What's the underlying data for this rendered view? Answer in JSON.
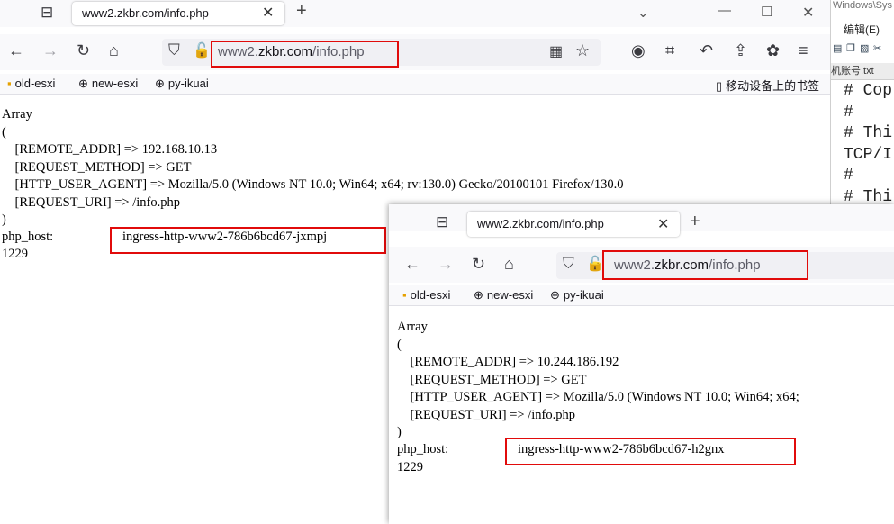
{
  "notepad": {
    "title_partial": "Windows\\Sys",
    "menu_edit": "编辑(E)",
    "tab_label": "机账号.txt",
    "lines": [
      "# Cop",
      "#",
      "# Thi",
      "TCP/I",
      "#",
      "# Thi"
    ]
  },
  "browser1": {
    "tab_title": "www2.zkbr.com/info.php",
    "url_prefix": "www2.",
    "url_host": "zkbr.com",
    "url_path": "/info.php",
    "bookmarks": [
      "old-esxi",
      "new-esxi",
      "py-ikuai"
    ],
    "mobile_bookmarks": "移动设备上的书签",
    "content": {
      "array_open": "Array",
      "paren_open": "(",
      "lines": [
        "    [REMOTE_ADDR] => 192.168.10.13",
        "    [REQUEST_METHOD] => GET",
        "    [HTTP_USER_AGENT] => Mozilla/5.0 (Windows NT 10.0; Win64; x64; rv:130.0) Gecko/20100101 Firefox/130.0",
        "    [REQUEST_URI] => /info.php"
      ],
      "paren_close": ")",
      "php_host_label": "php_host:",
      "php_host_value": "ingress-http-www2-786b6bcd67-jxmpj",
      "number": "1229"
    }
  },
  "browser2": {
    "tab_title": "www2.zkbr.com/info.php",
    "url_prefix": "www2.",
    "url_host": "zkbr.com",
    "url_path": "/info.php",
    "bookmarks": [
      "old-esxi",
      "new-esxi",
      "py-ikuai"
    ],
    "content": {
      "array_open": "Array",
      "paren_open": "(",
      "lines": [
        "    [REMOTE_ADDR] => 10.244.186.192",
        "    [REQUEST_METHOD] => GET",
        "    [HTTP_USER_AGENT] => Mozilla/5.0 (Windows NT 10.0; Win64; x64;",
        "    [REQUEST_URI] => /info.php"
      ],
      "paren_close": ")",
      "php_host_label": "php_host:",
      "php_host_value": "ingress-http-www2-786b6bcd67-h2gnx",
      "number": "1229"
    }
  },
  "colors": {
    "highlight": "#e10b0b",
    "chrome_bg": "#f9f9fb",
    "urlbar_bg": "#f0f0f4"
  }
}
